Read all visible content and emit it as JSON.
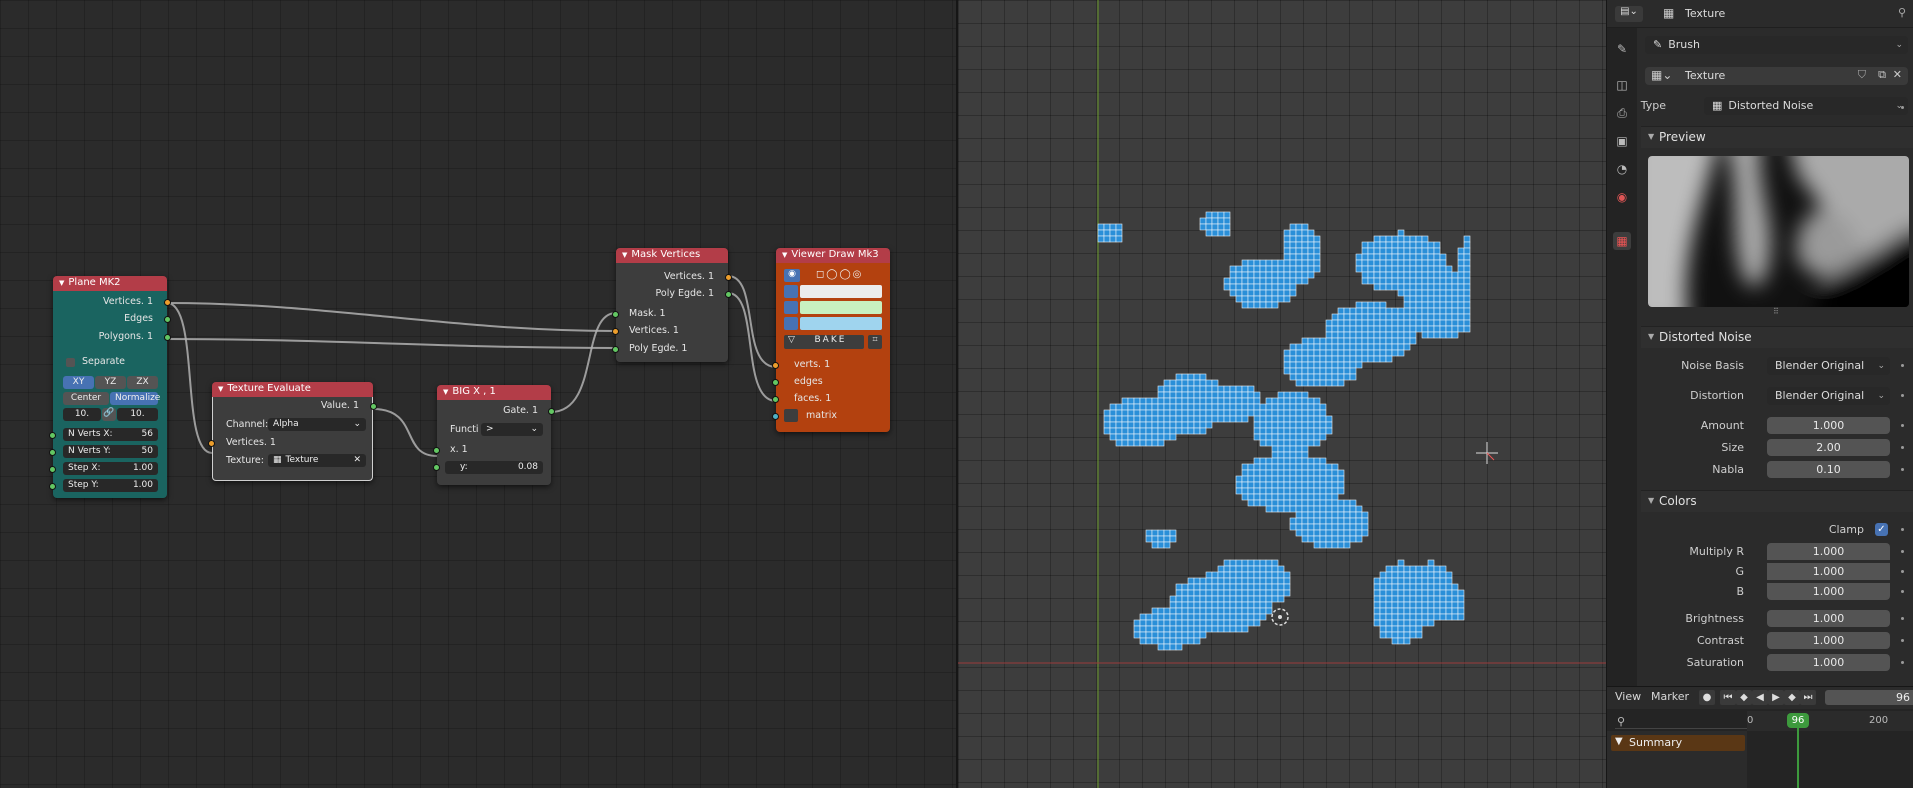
{
  "nodes": {
    "plane": {
      "title": "Plane MK2",
      "outputs": [
        "Vertices. 1",
        "Edges",
        "Polygons. 1"
      ],
      "separate_label": "Separate",
      "planes": [
        "XY",
        "YZ",
        "ZX"
      ],
      "center_label": "Center",
      "normalize_label": "Normalize",
      "dim_x": "10.",
      "dim_y": "10.",
      "fields": [
        {
          "label": "N Verts X:",
          "value": "56"
        },
        {
          "label": "N Verts Y:",
          "value": "50"
        },
        {
          "label": "Step X:",
          "value": "1.00"
        },
        {
          "label": "Step Y:",
          "value": "1.00"
        }
      ]
    },
    "texture_eval": {
      "title": "Texture Evaluate",
      "output": "Value. 1",
      "channel_label": "Channel:",
      "channel_value": "Alpha",
      "input": "Vertices. 1",
      "texture_label": "Texture:",
      "texture_value": "Texture"
    },
    "bigx": {
      "title": "BIG X , 1",
      "output": "Gate. 1",
      "func_label": "Functi",
      "func_value": ">",
      "input_x": "x. 1",
      "y_label": "y:",
      "y_value": "0.08"
    },
    "mask": {
      "title": "Mask Vertices",
      "outputs": [
        "Vertices. 1",
        "Poly Egde. 1"
      ],
      "inputs": [
        "Mask. 1",
        "Vertices. 1",
        "Poly Egde. 1"
      ]
    },
    "viewer": {
      "title": "Viewer Draw Mk3",
      "bake_label": "BAKE",
      "inputs": [
        "verts. 1",
        "edges",
        "faces. 1",
        "matrix"
      ],
      "colors": [
        "#ececec",
        "#c8f0c0",
        "#9fd4ee"
      ]
    }
  },
  "properties": {
    "header_title": "Texture",
    "brush_select": "Brush",
    "texture_name": "Texture",
    "type_label": "Type",
    "type_value": "Distorted Noise",
    "preview_title": "Preview",
    "distorted_noise_title": "Distorted Noise",
    "noise_basis_label": "Noise Basis",
    "noise_basis_value": "Blender Original",
    "distortion_label": "Distortion",
    "distortion_value": "Blender Original",
    "amount_label": "Amount",
    "amount_value": "1.000",
    "size_label": "Size",
    "size_value": "2.00",
    "nabla_label": "Nabla",
    "nabla_value": "0.10",
    "colors_title": "Colors",
    "clamp_label": "Clamp",
    "mult_r_label": "Multiply R",
    "mult_r_value": "1.000",
    "g_label": "G",
    "g_value": "1.000",
    "b_label": "B",
    "b_value": "1.000",
    "brightness_label": "Brightness",
    "brightness_value": "1.000",
    "contrast_label": "Contrast",
    "contrast_value": "1.000",
    "saturation_label": "Saturation",
    "saturation_value": "1.000"
  },
  "timeline": {
    "view_label": "View",
    "marker_label": "Marker",
    "current_frame": "96",
    "frame_display": "96",
    "ruler": [
      "0",
      "96",
      "200"
    ],
    "summary_label": "Summary"
  },
  "colors": {
    "node_header_red": "#b33d48",
    "plane_body_teal": "#1a6460",
    "viewer_body_orange": "#b3410f",
    "mask_blue": "#2a8fd8",
    "accent_blue": "#4772b3"
  }
}
